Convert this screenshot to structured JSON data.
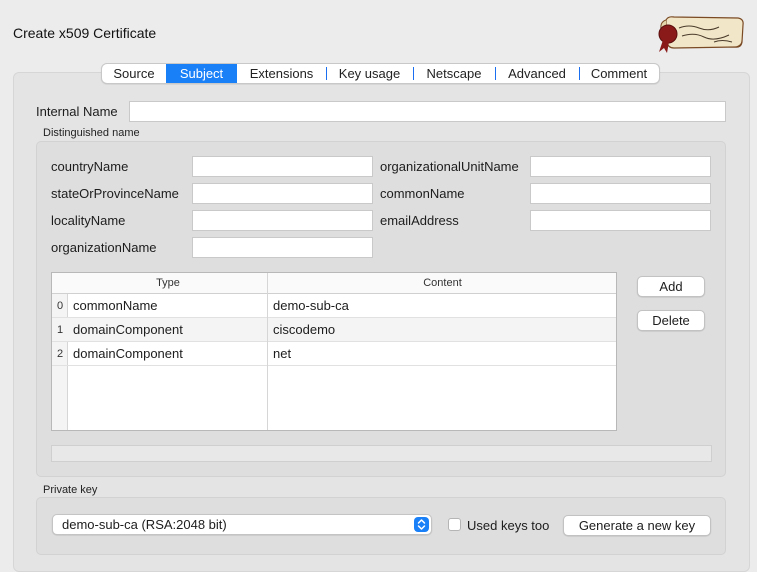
{
  "window": {
    "title": "Create x509 Certificate"
  },
  "logo": {
    "icon": "scroll-seal-logo-icon"
  },
  "tabs": [
    {
      "label": "Source",
      "active": false
    },
    {
      "label": "Subject",
      "active": true
    },
    {
      "label": "Extensions",
      "active": false
    },
    {
      "label": "Key usage",
      "active": false
    },
    {
      "label": "Netscape",
      "active": false
    },
    {
      "label": "Advanced",
      "active": false
    },
    {
      "label": "Comment",
      "active": false
    }
  ],
  "internal_name": {
    "label": "Internal Name",
    "value": ""
  },
  "dn": {
    "title": "Distinguished name",
    "country_name": {
      "label": "countryName",
      "value": ""
    },
    "state_name": {
      "label": "stateOrProvinceName",
      "value": ""
    },
    "locality_name": {
      "label": "localityName",
      "value": ""
    },
    "organization_name": {
      "label": "organizationName",
      "value": ""
    },
    "org_unit_name": {
      "label": "organizationalUnitName",
      "value": ""
    },
    "common_name": {
      "label": "commonName",
      "value": ""
    },
    "email_address": {
      "label": "emailAddress",
      "value": ""
    }
  },
  "table": {
    "headers": [
      "Type",
      "Content"
    ],
    "rows": [
      {
        "index": "0",
        "type": "commonName",
        "content": "demo-sub-ca"
      },
      {
        "index": "1",
        "type": "domainComponent",
        "content": "ciscodemo"
      },
      {
        "index": "2",
        "type": "domainComponent",
        "content": "net"
      }
    ]
  },
  "buttons": {
    "add": "Add",
    "delete": "Delete"
  },
  "private_key": {
    "title": "Private key",
    "selected": "demo-sub-ca (RSA:2048 bit)",
    "used_keys_label": "Used keys too",
    "used_keys_checked": false,
    "generate_label": "Generate a new key"
  },
  "colors": {
    "accent": "#1a80f8"
  }
}
